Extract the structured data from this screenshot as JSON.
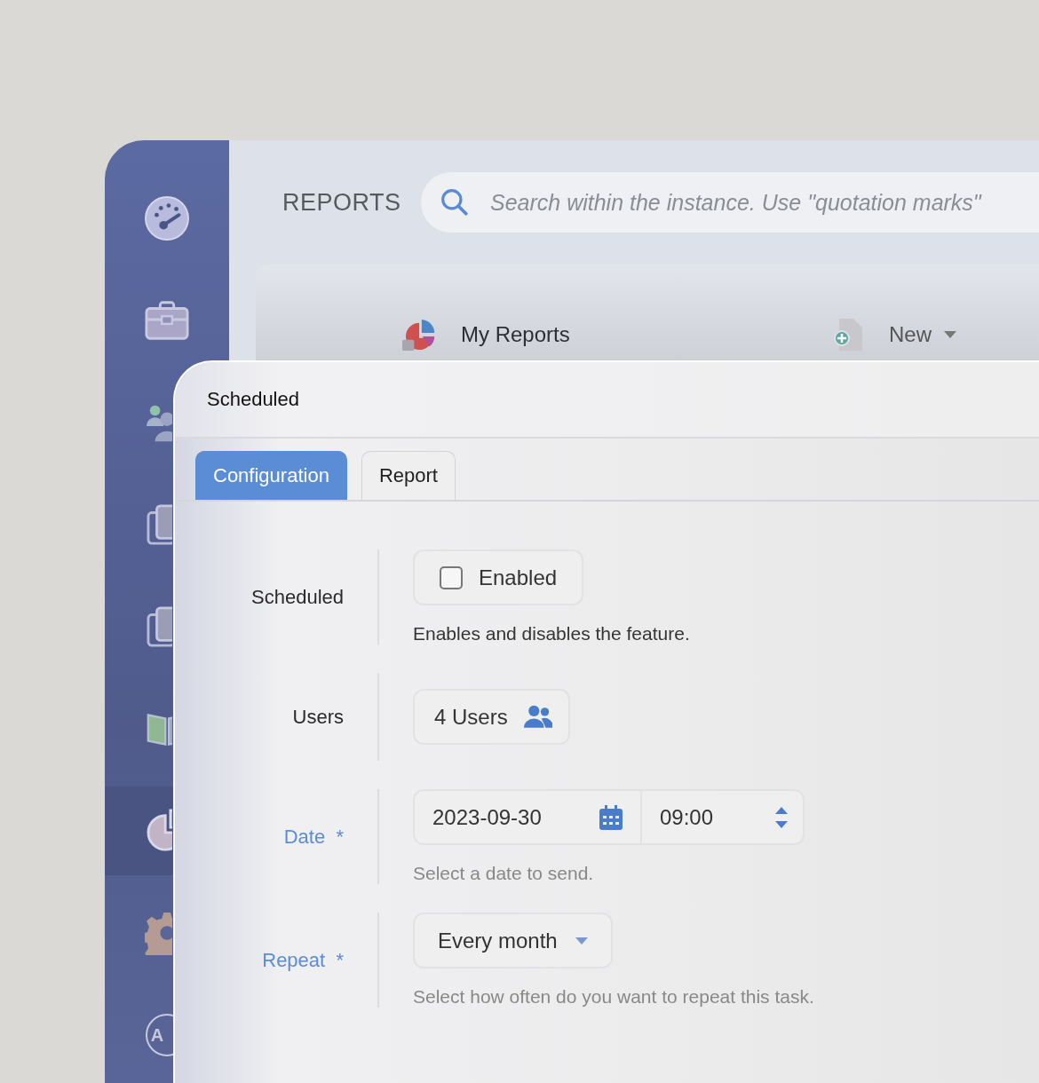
{
  "sidebar": {
    "items": [
      {
        "kind": "gauge",
        "selected": false
      },
      {
        "kind": "briefcase",
        "selected": false
      },
      {
        "kind": "people",
        "selected": false
      },
      {
        "kind": "docs",
        "selected": false
      },
      {
        "kind": "docs",
        "selected": false
      },
      {
        "kind": "book",
        "selected": false
      },
      {
        "kind": "pie",
        "selected": true
      },
      {
        "kind": "gear",
        "selected": false
      },
      {
        "kind": "avatar",
        "initials": "A",
        "selected": false
      }
    ]
  },
  "header": {
    "title": "REPORTS",
    "search": {
      "placeholder": "Search within the instance. Use \"quotation marks\""
    }
  },
  "toolbar": {
    "title": "My Reports",
    "new_button": "New"
  },
  "dialog": {
    "title": "Scheduled",
    "tabs": [
      {
        "label": "Configuration",
        "selected": true
      },
      {
        "label": "Report",
        "selected": false
      }
    ],
    "fields": [
      {
        "kind": "checkbox",
        "label": "Scheduled",
        "required": false,
        "option": "Enabled",
        "checked": false,
        "help": "Enables and disables the feature."
      },
      {
        "kind": "users",
        "label": "Users",
        "required": false,
        "value": "4 Users"
      },
      {
        "kind": "datetime",
        "label": "Date",
        "required": true,
        "required_mark": "*",
        "date": "2023-09-30",
        "time": "09:00",
        "help": "Select a date to send."
      },
      {
        "kind": "select",
        "label": "Repeat",
        "required": true,
        "required_mark": "*",
        "value": "Every month",
        "help": "Select how often do you want to repeat this task."
      }
    ]
  }
}
